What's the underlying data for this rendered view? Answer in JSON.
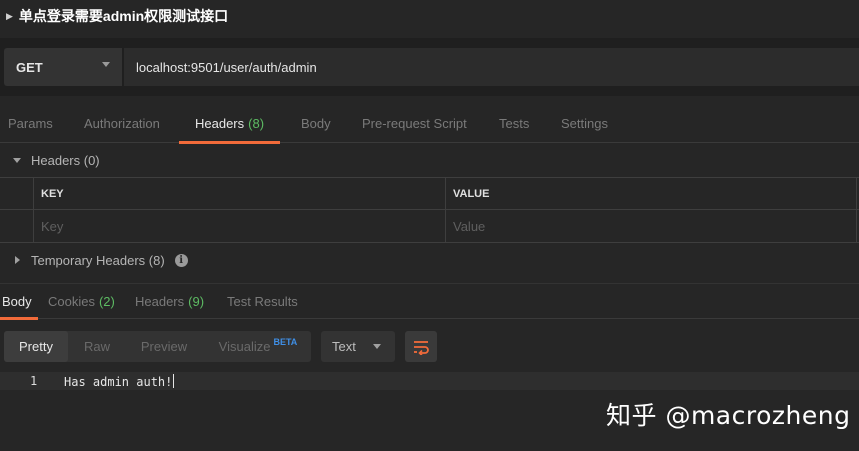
{
  "request": {
    "name": "单点登录需要admin权限测试接口",
    "method": "GET",
    "url": "localhost:9501/user/auth/admin"
  },
  "request_tabs": [
    {
      "label": "Params",
      "count": "",
      "active": false
    },
    {
      "label": "Authorization",
      "count": "",
      "active": false
    },
    {
      "label": "Headers",
      "count": "(8)",
      "active": true
    },
    {
      "label": "Body",
      "count": "",
      "active": false
    },
    {
      "label": "Pre-request Script",
      "count": "",
      "active": false
    },
    {
      "label": "Tests",
      "count": "",
      "active": false
    },
    {
      "label": "Settings",
      "count": "",
      "active": false
    }
  ],
  "headers_section": {
    "title": "Headers (0)",
    "key_header": "KEY",
    "value_header": "VALUE",
    "key_placeholder": "Key",
    "value_placeholder": "Value"
  },
  "temp_headers": {
    "title": "Temporary Headers (8)",
    "info_glyph": "i"
  },
  "response_tabs": [
    {
      "label": "Body",
      "count": "",
      "active": true
    },
    {
      "label": "Cookies",
      "count": "(2)",
      "active": false
    },
    {
      "label": "Headers",
      "count": "(9)",
      "active": false
    },
    {
      "label": "Test Results",
      "count": "",
      "active": false
    }
  ],
  "view_modes": {
    "pretty": "Pretty",
    "raw": "Raw",
    "preview": "Preview",
    "visualize": "Visualize",
    "beta": "BETA"
  },
  "format_select": "Text",
  "response_body": {
    "line_number": "1",
    "text": "Has admin auth!"
  },
  "watermark": "知乎 @macrozheng",
  "colors": {
    "accent": "#f26b3a",
    "count_green": "#5dbb63",
    "beta_blue": "#3f8fe6",
    "background": "#262626"
  }
}
